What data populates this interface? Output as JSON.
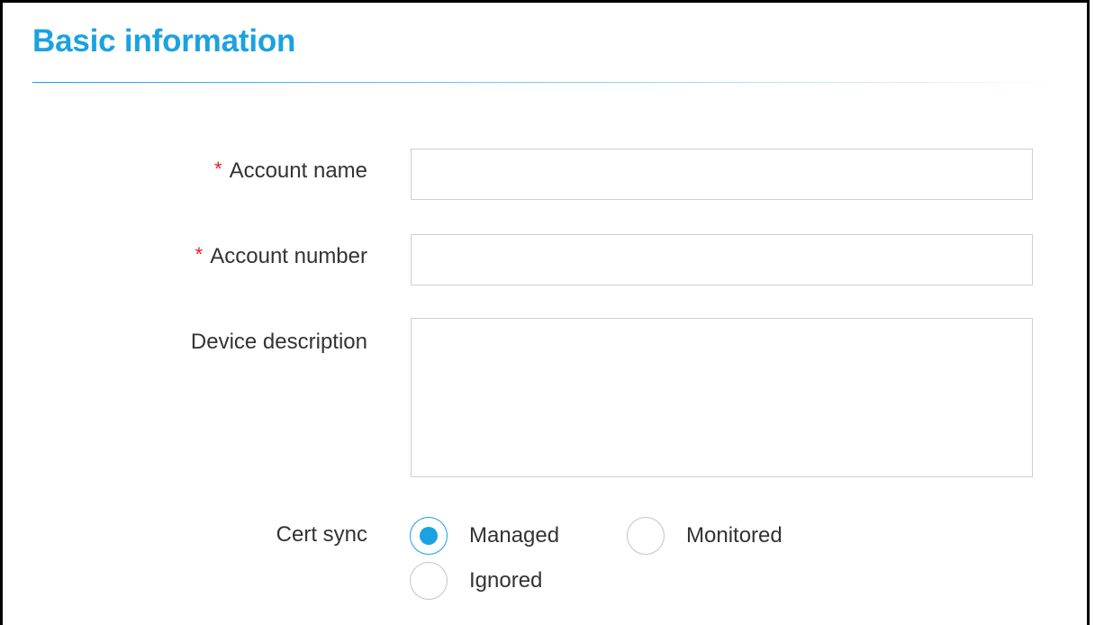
{
  "section": {
    "title": "Basic information"
  },
  "form": {
    "account_name": {
      "label": "Account name",
      "required_mark": "*",
      "value": "",
      "placeholder": ""
    },
    "account_number": {
      "label": "Account number",
      "required_mark": "*",
      "value": "",
      "placeholder": ""
    },
    "device_description": {
      "label": "Device description",
      "value": "",
      "placeholder": ""
    },
    "cert_sync": {
      "label": "Cert sync",
      "options": [
        {
          "label": "Managed",
          "selected": true
        },
        {
          "label": "Monitored",
          "selected": false
        },
        {
          "label": "Ignored",
          "selected": false
        }
      ]
    }
  },
  "colors": {
    "accent": "#1ba2e0",
    "required": "#e02020",
    "border": "#cfcfcf"
  }
}
